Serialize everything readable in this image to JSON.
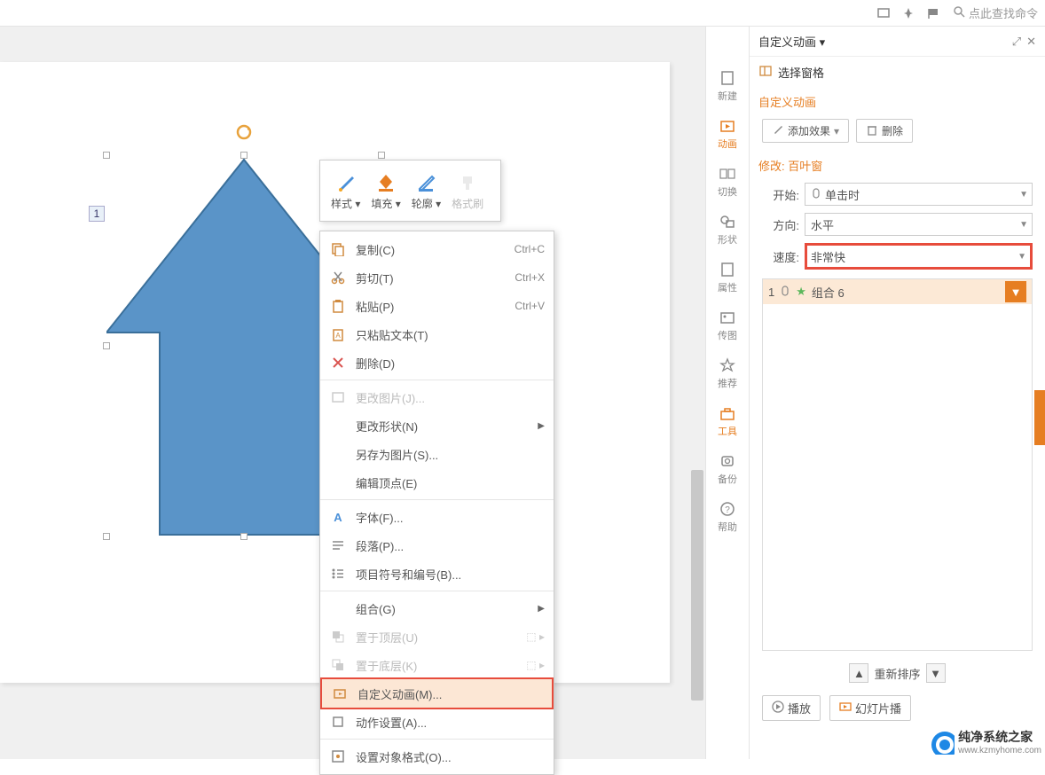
{
  "top": {
    "search_placeholder": "点此查找命令"
  },
  "slide": {
    "seq_tag": "1"
  },
  "float_toolbar": {
    "style": "样式",
    "fill": "填充",
    "outline": "轮廓",
    "format_painter": "格式刷"
  },
  "context_menu": {
    "copy": {
      "label": "复制(C)",
      "shortcut": "Ctrl+C"
    },
    "cut": {
      "label": "剪切(T)",
      "shortcut": "Ctrl+X"
    },
    "paste": {
      "label": "粘贴(P)",
      "shortcut": "Ctrl+V"
    },
    "paste_text": {
      "label": "只粘贴文本(T)"
    },
    "delete": {
      "label": "删除(D)"
    },
    "change_pic": {
      "label": "更改图片(J)..."
    },
    "change_shape": {
      "label": "更改形状(N)"
    },
    "save_as_pic": {
      "label": "另存为图片(S)..."
    },
    "edit_points": {
      "label": "编辑顶点(E)"
    },
    "font": {
      "label": "字体(F)..."
    },
    "paragraph": {
      "label": "段落(P)..."
    },
    "bullets": {
      "label": "项目符号和编号(B)..."
    },
    "group": {
      "label": "组合(G)"
    },
    "bring_front": {
      "label": "置于顶层(U)"
    },
    "send_back": {
      "label": "置于底层(K)"
    },
    "custom_anim": {
      "label": "自定义动画(M)..."
    },
    "action_settings": {
      "label": "动作设置(A)..."
    },
    "format_object": {
      "label": "设置对象格式(O)..."
    }
  },
  "side_nav": {
    "new": "新建",
    "animation": "动画",
    "transition": "切换",
    "shape": "形状",
    "properties": "属性",
    "upload_pic": "传图",
    "recommend": "推荐",
    "tools": "工具",
    "backup": "备份",
    "help": "帮助"
  },
  "panel": {
    "title": "自定义动画",
    "select_pane": "选择窗格",
    "custom_anim_title": "自定义动画",
    "add_effect": "添加效果",
    "delete": "删除",
    "modify_label": "修改: 百叶窗",
    "start_label": "开始:",
    "start_value": "单击时",
    "direction_label": "方向:",
    "direction_value": "水平",
    "speed_label": "速度:",
    "speed_value": "非常快",
    "anim_item": {
      "num": "1",
      "name": "组合 6"
    },
    "reorder": "重新排序",
    "play": "播放",
    "slideshow": "幻灯片播"
  },
  "watermark": {
    "title": "纯净系统之家",
    "url": "www.kzmyhome.com"
  }
}
